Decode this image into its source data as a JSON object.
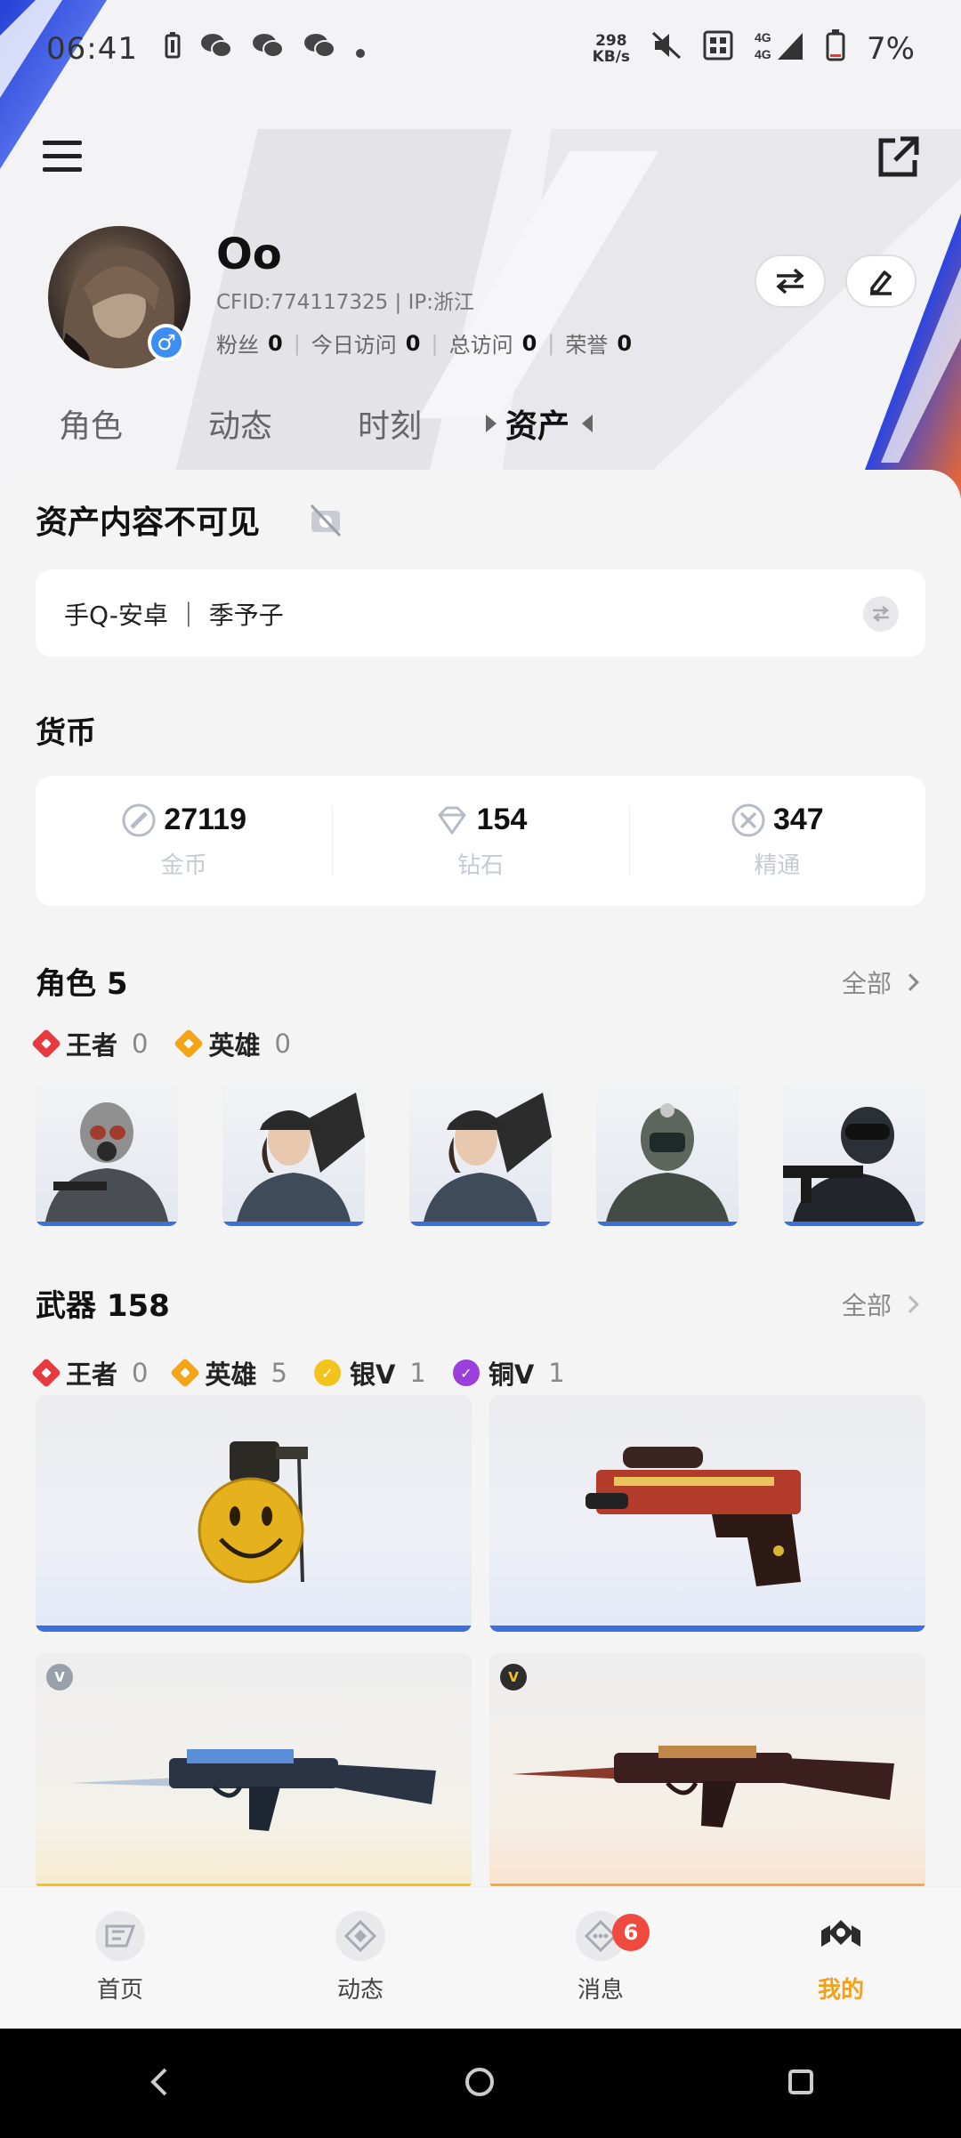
{
  "status_bar": {
    "time": "06:41",
    "speed_value": "298",
    "speed_unit": "KB/s",
    "battery": "7%"
  },
  "profile": {
    "name": "Oo",
    "cfid_line": "CFID:774117325 | IP:浙江",
    "gender_symbol": "♂",
    "stats": [
      {
        "label": "粉丝",
        "value": "0"
      },
      {
        "label": "今日访问",
        "value": "0"
      },
      {
        "label": "总访问",
        "value": "0"
      },
      {
        "label": "荣誉",
        "value": "0"
      }
    ]
  },
  "tabs": [
    "角色",
    "动态",
    "时刻",
    "资产"
  ],
  "active_tab": "资产",
  "privacy": {
    "title": "资产内容不可见"
  },
  "account": {
    "text": "手Q-安卓 ｜ 季予子"
  },
  "currency": {
    "title": "货币",
    "items": [
      {
        "value": "27119",
        "label": "金币",
        "icon": "coin-icon"
      },
      {
        "value": "154",
        "label": "钻石",
        "icon": "diamond-icon"
      },
      {
        "value": "347",
        "label": "精通",
        "icon": "mastery-icon"
      }
    ]
  },
  "characters": {
    "title": "角色 5",
    "all_label": "全部",
    "rarities": [
      {
        "name": "王者",
        "count": "0",
        "color": "#e8393f"
      },
      {
        "name": "英雄",
        "count": "0",
        "color": "#f5a418"
      }
    ],
    "items": [
      "soldier-gasmask",
      "female-soldier-cap",
      "female-soldier-cap",
      "helmet-soldier",
      "swat-soldier"
    ]
  },
  "weapons": {
    "title": "武器 158",
    "all_label": "全部",
    "rarities": [
      {
        "name": "王者",
        "count": "0",
        "color": "#e8393f"
      },
      {
        "name": "英雄",
        "count": "5",
        "color": "#f5a418"
      },
      {
        "name": "银V",
        "count": "1",
        "color": "#f3c21b"
      },
      {
        "name": "铜V",
        "count": "1",
        "color": "#9a3fdc"
      }
    ],
    "items": [
      {
        "name": "smile-grenade",
        "bar_color": "#3d6fdb"
      },
      {
        "name": "desert-eagle",
        "bar_color": "#3d6fdb"
      },
      {
        "name": "ak47-silver",
        "bar_color": "#f7c51a",
        "badge": "V"
      },
      {
        "name": "ak47-dragon",
        "bar_color": "#f8a93b",
        "badge": "V"
      }
    ]
  },
  "bottom_nav": [
    {
      "label": "首页"
    },
    {
      "label": "动态"
    },
    {
      "label": "消息",
      "badge": "6"
    },
    {
      "label": "我的",
      "active": true
    }
  ],
  "colors": {
    "accent_gold": "#f0a21f",
    "hero_blue": "#2346d8",
    "hero_orange": "#f0682a"
  }
}
